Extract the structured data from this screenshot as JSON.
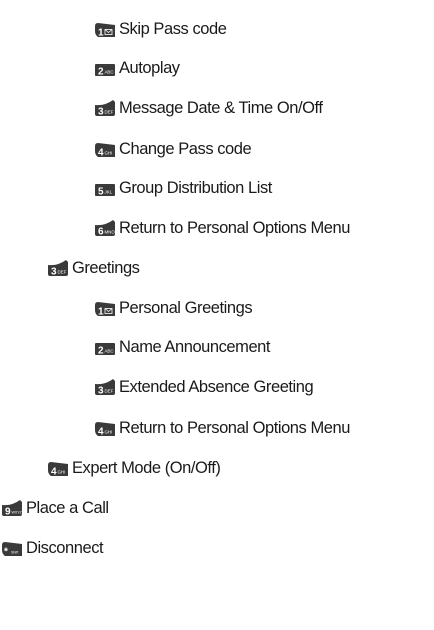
{
  "menu": {
    "items": [
      {
        "level": 2,
        "key": {
          "digit": "1",
          "sub": "",
          "icon": "envelope",
          "shape": "left-cut"
        },
        "label": "Skip Pass code"
      },
      {
        "level": 2,
        "key": {
          "digit": "2",
          "sub": "ABC",
          "shape": "flat"
        },
        "label": "Autoplay"
      },
      {
        "level": 2,
        "key": {
          "digit": "3",
          "sub": "DEF",
          "shape": "right-up"
        },
        "label": "Message Date & Time On/Off"
      },
      {
        "level": 2,
        "key": {
          "digit": "4",
          "sub": "GHI",
          "shape": "left-cut"
        },
        "label": "Change Pass code"
      },
      {
        "level": 2,
        "key": {
          "digit": "5",
          "sub": "JKL",
          "shape": "flat"
        },
        "label": "Group Distribution List"
      },
      {
        "level": 2,
        "key": {
          "digit": "6",
          "sub": "MNO",
          "shape": "right-up"
        },
        "label": "Return to Personal Options Menu"
      },
      {
        "level": 1,
        "key": {
          "digit": "3",
          "sub": "DEF",
          "shape": "right-up"
        },
        "label": "Greetings"
      },
      {
        "level": 2,
        "key": {
          "digit": "1",
          "sub": "",
          "icon": "envelope",
          "shape": "left-cut"
        },
        "label": "Personal Greetings"
      },
      {
        "level": 2,
        "key": {
          "digit": "2",
          "sub": "ABC",
          "shape": "flat"
        },
        "label": "Name Announcement"
      },
      {
        "level": 2,
        "key": {
          "digit": "3",
          "sub": "DEF",
          "shape": "right-up"
        },
        "label": "Extended Absence Greeting"
      },
      {
        "level": 2,
        "key": {
          "digit": "4",
          "sub": "GHI",
          "shape": "left-cut"
        },
        "label": "Return to Personal Options Menu"
      },
      {
        "level": 1,
        "key": {
          "digit": "4",
          "sub": "GHI",
          "shape": "left-cut"
        },
        "label": "Expert Mode (On/Off)"
      },
      {
        "level": 0,
        "key": {
          "digit": "9",
          "sub": "WXYZ",
          "shape": "right-up"
        },
        "label": "Place a Call"
      },
      {
        "level": 0,
        "key": {
          "digit": "*",
          "sub": "Shift",
          "shape": "left-cut"
        },
        "label": "Disconnect"
      }
    ]
  },
  "colors": {
    "key_fill": "#3a3a3a",
    "key_text": "#ffffff",
    "label_text": "#1a1a1a"
  }
}
